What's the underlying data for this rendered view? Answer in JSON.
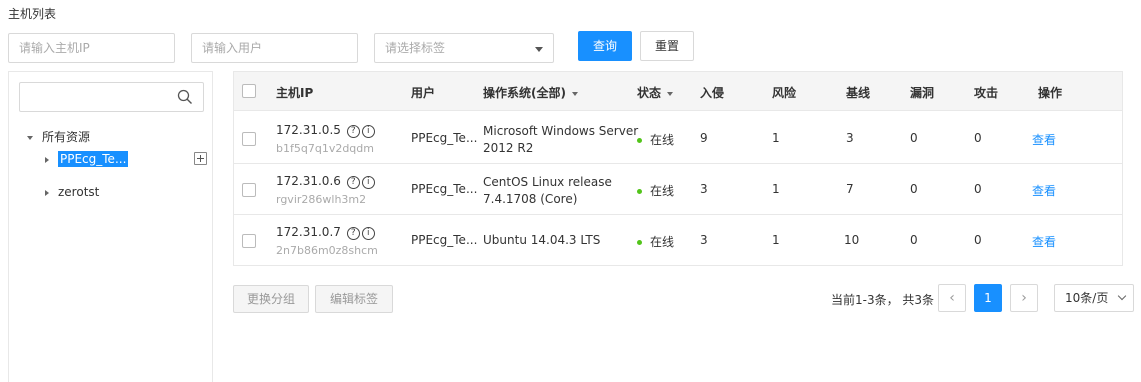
{
  "page_title": "主机列表",
  "filters": {
    "ip_placeholder": "请输入主机IP",
    "user_placeholder": "请输入用户",
    "tag_placeholder": "请选择标签",
    "query_label": "查询",
    "reset_label": "重置"
  },
  "tree": {
    "search_placeholder": "",
    "root_label": "所有资源",
    "nodes": [
      {
        "label": "PPEcg_Te...",
        "selected": true
      },
      {
        "label": "zerotst",
        "selected": false
      }
    ]
  },
  "table": {
    "headers": {
      "ip": "主机IP",
      "user": "用户",
      "os": "操作系统(全部)",
      "status": "状态",
      "intrusion": "入侵",
      "risk": "风险",
      "baseline": "基线",
      "vuln": "漏洞",
      "attack": "攻击",
      "action": "操作"
    },
    "rows": [
      {
        "ip": "172.31.0.5",
        "host_id": "b1f5q7q1v2dqdm",
        "user": "PPEcg_Te...",
        "os_line1": "Microsoft Windows Server",
        "os_line2": "2012 R2",
        "status": "在线",
        "intrusion": "9",
        "risk": "1",
        "baseline": "3",
        "vuln": "0",
        "attack": "0",
        "action": "查看"
      },
      {
        "ip": "172.31.0.6",
        "host_id": "rgvir286wlh3m2",
        "user": "PPEcg_Te...",
        "os_line1": "CentOS Linux release",
        "os_line2": "7.4.1708 (Core)",
        "status": "在线",
        "intrusion": "3",
        "risk": "1",
        "baseline": "7",
        "vuln": "0",
        "attack": "0",
        "action": "查看"
      },
      {
        "ip": "172.31.0.7",
        "host_id": "2n7b86m0z8shcm",
        "user": "PPEcg_Te...",
        "os_line1": "Ubuntu 14.04.3 LTS",
        "os_line2": "",
        "status": "在线",
        "intrusion": "3",
        "risk": "1",
        "baseline": "10",
        "vuln": "0",
        "attack": "0",
        "action": "查看"
      }
    ],
    "help_glyph": "?",
    "info_glyph": "i"
  },
  "bulk": {
    "change_group_label": "更换分组",
    "edit_tag_label": "编辑标签"
  },
  "pagination": {
    "summary": "当前1-3条， 共3条",
    "prev": "‹",
    "current_page": "1",
    "next": "›",
    "page_size": "10条/页"
  },
  "colors": {
    "primary": "#1890ff",
    "online": "#52c41a"
  }
}
